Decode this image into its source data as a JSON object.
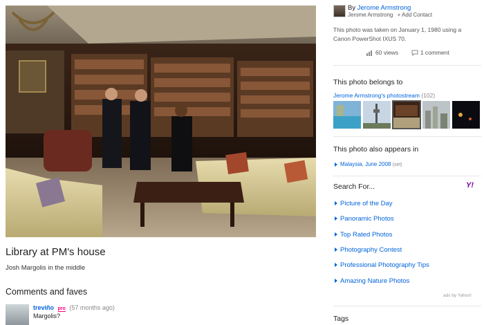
{
  "photo": {
    "title": "Library at PM's house",
    "description": "Josh Margolis in the middle"
  },
  "comments": {
    "heading": "Comments and faves",
    "items": [
      {
        "author": "treviño",
        "badge": "pro",
        "time": "(57 months ago)",
        "text": "Margolis?"
      }
    ]
  },
  "owner": {
    "by": "By",
    "name": "Jerome Armstrong",
    "sub_name": "Jerome Armstrong",
    "add_contact": "+ Add Contact"
  },
  "taken": "This photo was taken on January 1, 1980 using a Canon PowerShot IXUS 70.",
  "stats": {
    "views": "60 views",
    "comments": "1 comment"
  },
  "belongs": {
    "heading": "This photo belongs to",
    "stream_label": "Jerome Armstrong's photostream",
    "stream_count": "(102)"
  },
  "appears": {
    "heading": "This photo also appears in",
    "album": "Malaysia, June 2008",
    "album_type": "(set)"
  },
  "search": {
    "heading": "Search For...",
    "links": [
      "Picture of the Day",
      "Panoramic Photos",
      "Top Rated Photos",
      "Photography Contest",
      "Professional Photography Tips",
      "Amazing Nature Photos"
    ],
    "ads_by": "ads by Yahoo!"
  },
  "tags": {
    "heading": "Tags"
  },
  "colors": {
    "link": "#0063dc",
    "pro": "#ff0084",
    "yahoo": "#7b0099"
  }
}
